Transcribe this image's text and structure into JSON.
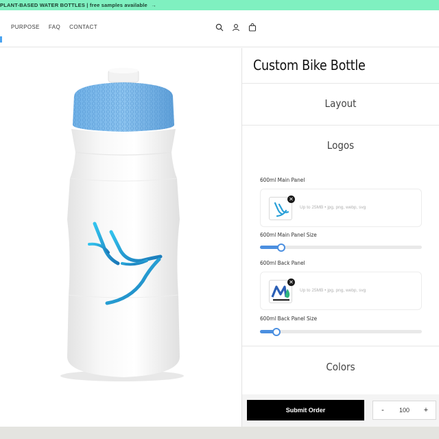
{
  "announcement": {
    "text": "PLANT-BASED WATER BOTTLES | free samples available",
    "arrow": "→"
  },
  "nav": {
    "items": [
      "PURPOSE",
      "FAQ",
      "CONTACT"
    ],
    "icons": [
      "search-icon",
      "account-icon",
      "cart-icon"
    ]
  },
  "product": {
    "title": "Custom Bike Bottle",
    "image": "bottle-icon",
    "accent_color": "#5aa9e6"
  },
  "sections": {
    "layout": "Layout",
    "logos": "Logos",
    "colors": "Colors"
  },
  "logos": {
    "main_panel_label": "600ml Main Panel",
    "main_panel_hint": "Up to 25MB • jpg, png, webp, svg",
    "main_size_label": "600ml Main Panel Size",
    "main_size_value": 0.13,
    "back_panel_label": "600ml Back Panel",
    "back_panel_hint": "Up to 25MB • jpg, png, webp, svg",
    "back_size_label": "600ml Back Panel Size",
    "back_size_value": 0.1,
    "remove_symbol": "✕"
  },
  "actions": {
    "submit_label": "Submit Order",
    "qty_minus": "-",
    "qty_value": "100",
    "qty_plus": "+"
  },
  "colors": {
    "announce_bg": "#7ff0c0",
    "slider": "#4b8fe0",
    "submit_bg": "#000000"
  }
}
